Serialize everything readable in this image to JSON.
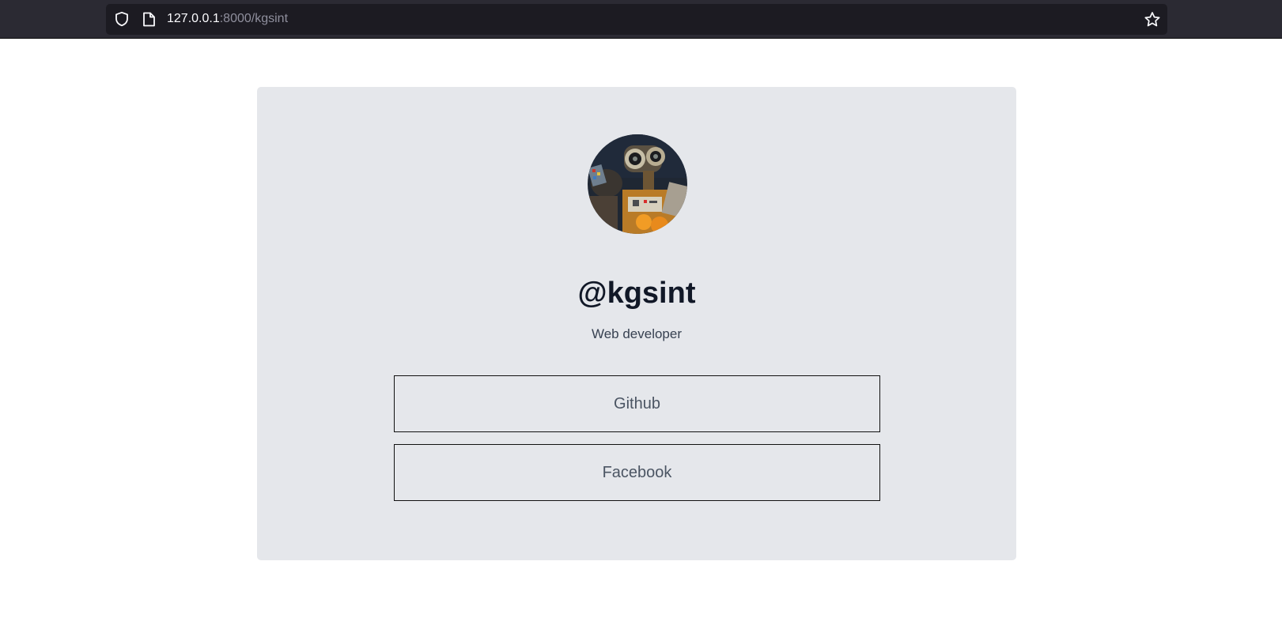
{
  "browser": {
    "url_host": "127.0.0.1",
    "url_path": ":8000/kgsint",
    "icons": [
      "shield-icon",
      "page-icon",
      "star-icon"
    ]
  },
  "profile": {
    "avatar": "robot-avatar",
    "handle": "@kgsint",
    "bio": "Web developer"
  },
  "links": [
    {
      "label": "Github"
    },
    {
      "label": "Facebook"
    }
  ],
  "colors": {
    "chrome_bg": "#2b2a33",
    "urlbar_bg": "#1c1b22",
    "card_bg": "#e5e7eb",
    "handle_text": "#111827",
    "link_text": "#4b5563"
  }
}
